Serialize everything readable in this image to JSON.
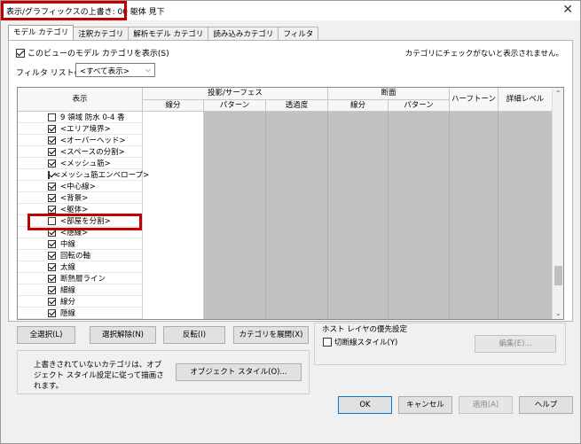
{
  "window": {
    "title": "表示/グラフィックスの上書き: 00 躯体 見下",
    "close_glyph": "✕"
  },
  "tabs": [
    {
      "label": "モデル カテゴリ",
      "active": true
    },
    {
      "label": "注釈カテゴリ",
      "active": false
    },
    {
      "label": "解析モデル カテゴリ",
      "active": false
    },
    {
      "label": "読み込みカテゴリ",
      "active": false
    },
    {
      "label": "フィルタ",
      "active": false
    }
  ],
  "show_categories": {
    "label": "このビューのモデル カテゴリを表示(S)",
    "checked": true
  },
  "note": "カテゴリにチェックがないと表示されません。",
  "filter": {
    "label": "フィルタ リスト(F):",
    "value": "<すべて表示>",
    "arrow": "⌵"
  },
  "grid": {
    "headers": {
      "visibility": "表示",
      "projection": "投影/サーフェス",
      "projection_cols": [
        "線分",
        "パターン",
        "透過度"
      ],
      "cut": "断面",
      "cut_cols": [
        "線分",
        "パターン"
      ],
      "halftone": "ハーフトーン",
      "detail_level": "詳細レベル"
    },
    "rows": [
      {
        "label": "9 領域 防水 0-4 香",
        "checked": false
      },
      {
        "label": "<エリア境界>",
        "checked": true
      },
      {
        "label": "<オーバーヘッド>",
        "checked": true
      },
      {
        "label": "<スペースの分割>",
        "checked": true
      },
      {
        "label": "<メッシュ筋>",
        "checked": true
      },
      {
        "label": "<メッシュ筋エンベロープ>",
        "checked": true
      },
      {
        "label": "<中心線>",
        "checked": true
      },
      {
        "label": "<背景>",
        "checked": true
      },
      {
        "label": "<躯体>",
        "checked": true
      },
      {
        "label": "<部屋を分割>",
        "checked": false
      },
      {
        "label": "<隠線>",
        "checked": true
      },
      {
        "label": "中線",
        "checked": true
      },
      {
        "label": "回転の軸",
        "checked": true
      },
      {
        "label": "太線",
        "checked": true
      },
      {
        "label": "断熱層ライン",
        "checked": true
      },
      {
        "label": "細線",
        "checked": true
      },
      {
        "label": "線分",
        "checked": true
      },
      {
        "label": "隠線",
        "checked": true
      }
    ],
    "scroll_up": "⌃",
    "scroll_down": "⌄"
  },
  "buttons": {
    "select_all": "全選択(L)",
    "deselect_all": "選択解除(N)",
    "invert": "反転(I)",
    "expand": "カテゴリを展開(X)",
    "object_styles": "オブジェクト スタイル(O)...",
    "edit": "編集(E)...",
    "ok": "OK",
    "cancel": "キャンセル",
    "apply": "適用(A)",
    "help": "ヘルプ"
  },
  "host_layer": {
    "title": "ホスト レイヤの優先設定",
    "cut_line_styles": {
      "label": "切断線スタイル(Y)",
      "checked": false
    }
  },
  "info_text": "上書きされていないカテゴリは、オブジェクト スタイル設定に従って描画されます。"
}
